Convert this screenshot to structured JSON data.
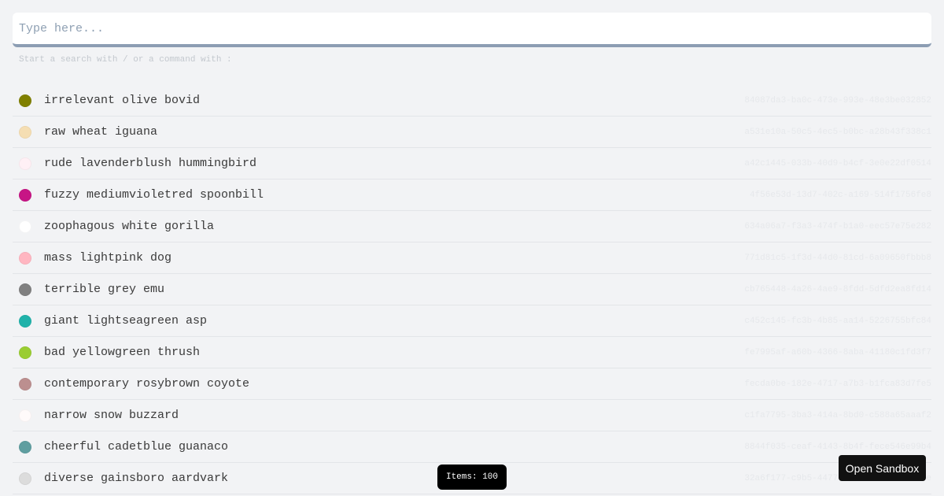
{
  "search": {
    "placeholder": "Type here...",
    "hint": "Start a search with / or a command with :"
  },
  "items": [
    {
      "name": "irrelevant olive bovid",
      "color": "#808000",
      "uuid": "84087da3-ba0c-473e-993e-48e3be032852"
    },
    {
      "name": "raw wheat iguana",
      "color": "#f5deb3",
      "uuid": "a531e10a-50c5-4ec5-b0bc-a28b43f338c1"
    },
    {
      "name": "rude lavenderblush hummingbird",
      "color": "#fff0f5",
      "uuid": "a42c1445-033b-40d9-b4cf-3e0e22df0514"
    },
    {
      "name": "fuzzy mediumvioletred spoonbill",
      "color": "#c71585",
      "uuid": "4f56e53d-13d7-402c-a169-514f1756fe8"
    },
    {
      "name": "zoophagous white gorilla",
      "color": "#ffffff",
      "uuid": "634a06a7-f3a3-474f-b1a0-eec57e75e282"
    },
    {
      "name": "mass lightpink dog",
      "color": "#ffb6c1",
      "uuid": "771d81c5-1f3d-44d0-81cd-6a09650fbbb8"
    },
    {
      "name": "terrible grey emu",
      "color": "#808080",
      "uuid": "cb765448-4a26-4ae9-8fdd-5dfd2ea8fd14"
    },
    {
      "name": "giant lightseagreen asp",
      "color": "#20b2aa",
      "uuid": "c452c145-fc3b-4b85-aa14-5226755bfc84"
    },
    {
      "name": "bad yellowgreen thrush",
      "color": "#9acd32",
      "uuid": "fe7995af-a60b-4366-8aba-41180c1fd3f7"
    },
    {
      "name": "contemporary rosybrown coyote",
      "color": "#bc8f8f",
      "uuid": "fecda0be-182e-4717-a7b3-b1fca83d7fe5"
    },
    {
      "name": "narrow snow buzzard",
      "color": "#fffafa",
      "uuid": "c1fa7795-3ba3-414a-8bd0-c588a65aaaf2"
    },
    {
      "name": "cheerful cadetblue guanaco",
      "color": "#5f9ea0",
      "uuid": "8844f035-ceaf-4143-8b4f-fece546e99b4"
    },
    {
      "name": "diverse gainsboro aardvark",
      "color": "#dcdcdc",
      "uuid": "32a6f177-c9b5-4477-8e11-5e92d1b70a1e"
    }
  ],
  "status": {
    "items_count": "Items: 100"
  },
  "sandbox": {
    "label": "Open Sandbox"
  }
}
